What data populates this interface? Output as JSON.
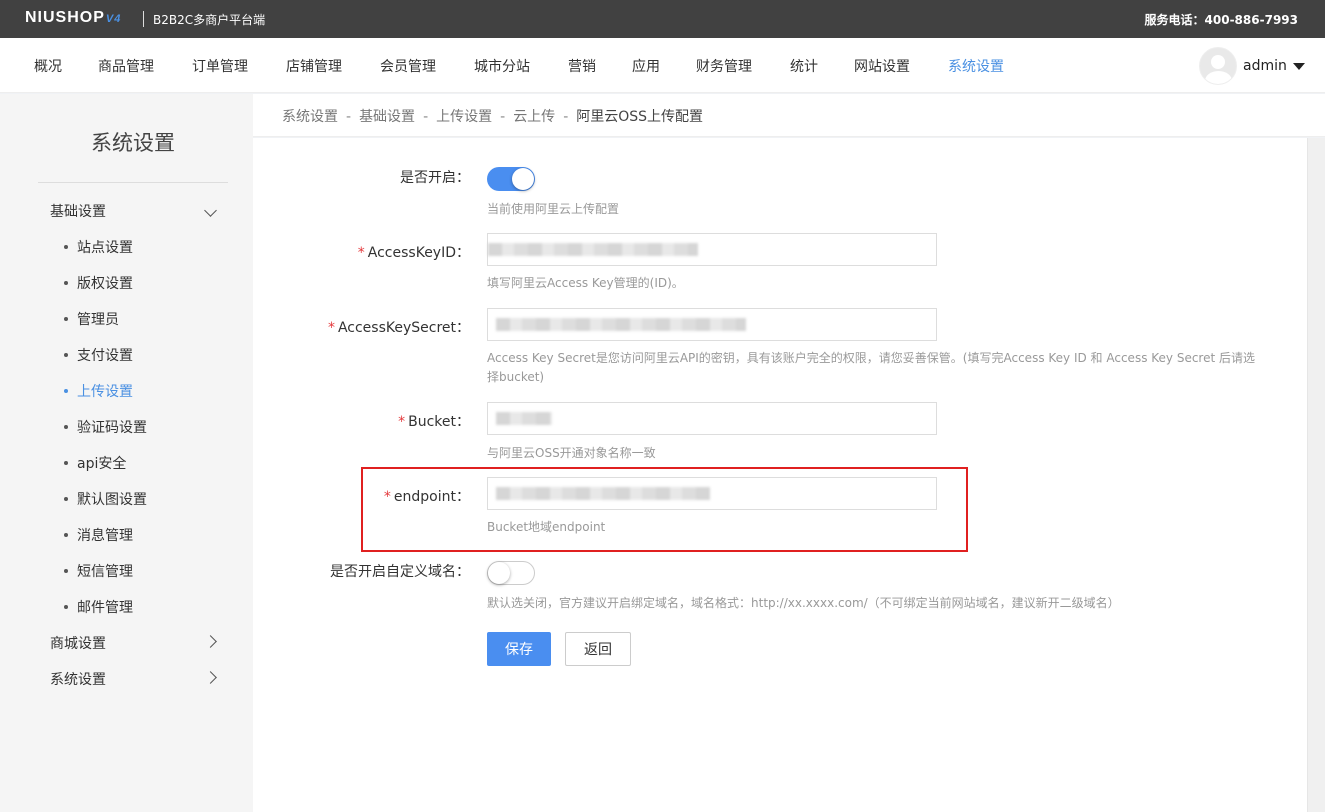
{
  "header": {
    "logo": "NIUSHOP",
    "logo_version": "V4",
    "platform": "B2B2C多商户平台端",
    "hotline": "服务电话：400-886-7993"
  },
  "nav": {
    "items": [
      "概况",
      "商品管理",
      "订单管理",
      "店铺管理",
      "会员管理",
      "城市分站",
      "营销",
      "应用",
      "财务管理",
      "统计",
      "网站设置",
      "系统设置"
    ],
    "active": "系统设置",
    "username": "admin"
  },
  "sidebar": {
    "title": "系统设置",
    "group1": "基础设置",
    "items": [
      "站点设置",
      "版权设置",
      "管理员",
      "支付设置",
      "上传设置",
      "验证码设置",
      "api安全",
      "默认图设置",
      "消息管理",
      "短信管理",
      "邮件管理"
    ],
    "active_item": "上传设置",
    "group2": "商城设置",
    "group3": "系统设置"
  },
  "breadcrumb": {
    "items": [
      "系统设置",
      "基础设置",
      "上传设置",
      "云上传"
    ],
    "current": "阿里云OSS上传配置",
    "separator": "-"
  },
  "form": {
    "enable_label": "是否开启：",
    "enable_on": true,
    "enable_hint": "当前使用阿里云上传配置",
    "required_mark": "*",
    "akid_label": "AccessKeyID：",
    "akid_hint": "填写阿里云Access Key管理的(ID)。",
    "aksecret_label": "AccessKeySecret：",
    "aksecret_hint": "Access Key Secret是您访问阿里云API的密钥，具有该账户完全的权限，请您妥善保管。(填写完Access Key ID 和 Access Key Secret 后请选择bucket)",
    "bucket_label": "Bucket：",
    "bucket_hint": "与阿里云OSS开通对象名称一致",
    "endpoint_label": "endpoint：",
    "endpoint_hint": "Bucket地域endpoint",
    "domain_label": "是否开启自定义域名：",
    "domain_on": false,
    "domain_hint": "默认选关闭，官方建议开启绑定域名，域名格式：http://xx.xxxx.com/（不可绑定当前网站域名，建议新开二级域名）",
    "save_label": "保存",
    "back_label": "返回"
  },
  "colors": {
    "accent": "#4a8ef0",
    "topbar": "#414141",
    "highlight": "#e02020"
  }
}
